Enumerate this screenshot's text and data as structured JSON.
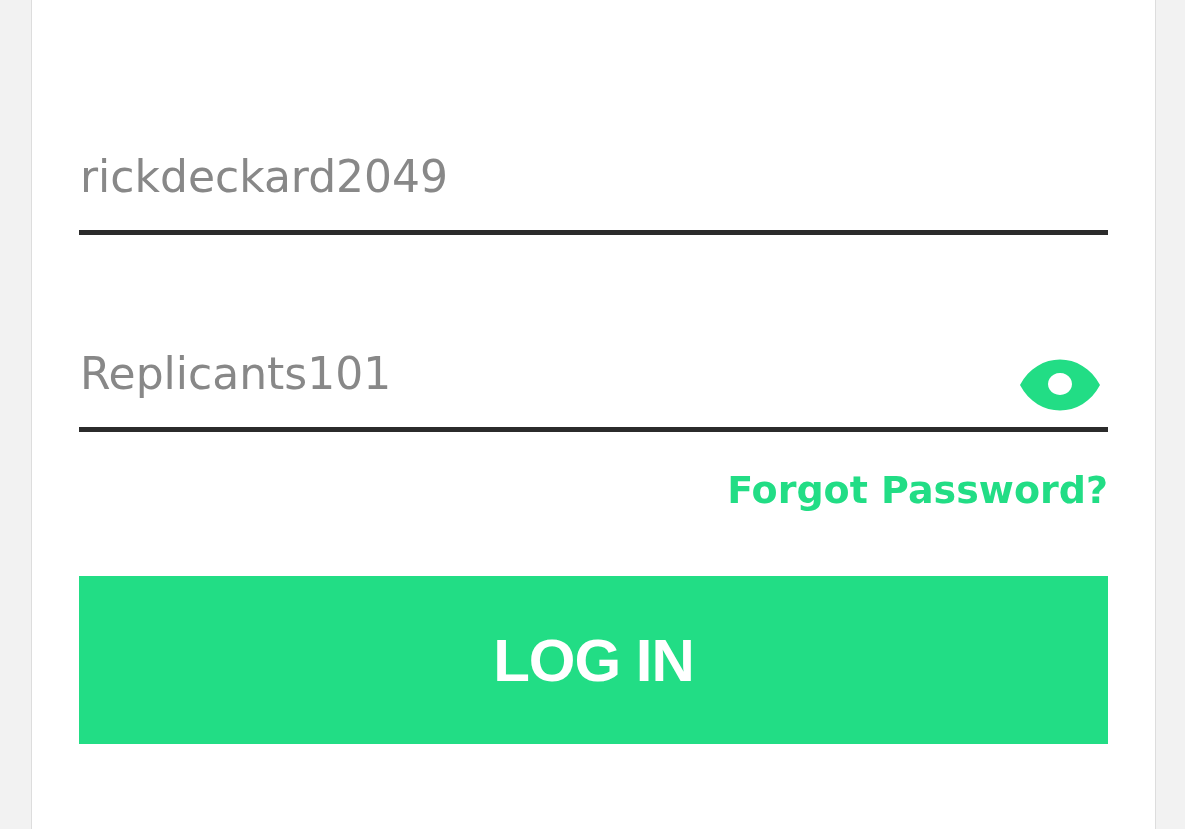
{
  "login_form": {
    "username": {
      "value": "rickdeckard2049"
    },
    "password": {
      "value": "Replicants101"
    },
    "forgot_password_link": "Forgot Password?",
    "login_button": "LOG IN"
  }
}
